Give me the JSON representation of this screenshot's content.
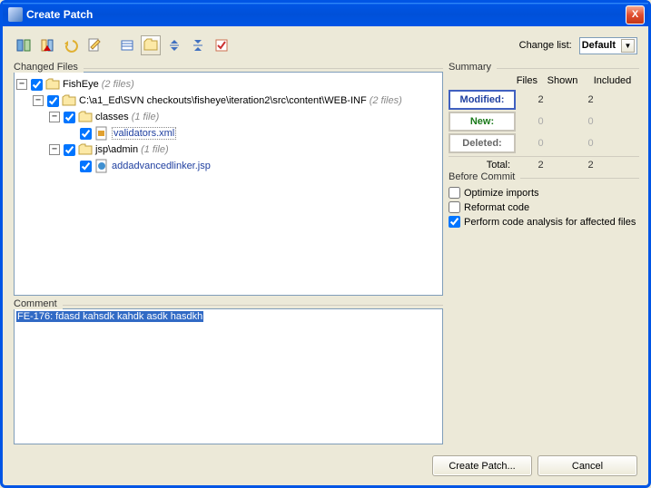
{
  "window": {
    "title": "Create Patch",
    "close_label": "X"
  },
  "toolbar": {
    "buttons": [
      "compare",
      "diff-options",
      "undo",
      "edit",
      "list",
      "tree",
      "expand-all",
      "collapse-all",
      "validate"
    ],
    "change_list_label": "Change list:",
    "change_list_value": "Default"
  },
  "sections": {
    "changed_files": "Changed Files",
    "comment": "Comment",
    "summary": "Summary",
    "before_commit": "Before Commit"
  },
  "tree": {
    "root": {
      "label": "FishEye",
      "count_label": "(2 files)",
      "checked": true,
      "children": [
        {
          "label": "C:\\a1_Ed\\SVN checkouts\\fisheye\\iteration2\\src\\content\\WEB-INF",
          "count_label": "(2 files)",
          "checked": true,
          "children": [
            {
              "label": "classes",
              "count_label": "(1 file)",
              "checked": true,
              "children": [
                {
                  "file": "validators.xml",
                  "checked": true,
                  "status": "M",
                  "selected": true
                }
              ]
            },
            {
              "label": "jsp\\admin",
              "count_label": "(1 file)",
              "checked": true,
              "children": [
                {
                  "file": "addadvancedlinker.jsp",
                  "checked": true,
                  "status": "Unknown"
                }
              ]
            }
          ]
        }
      ]
    }
  },
  "comment": {
    "text": "FE-176: fdasd kahsdk kahdk asdk hasdkh"
  },
  "summary": {
    "cols": {
      "files": "Files",
      "shown": "Shown",
      "included": "Included"
    },
    "rows": {
      "modified": {
        "label": "Modified:",
        "shown": "2",
        "included": "2"
      },
      "new": {
        "label": "New:",
        "shown": "0",
        "included": "0"
      },
      "deleted": {
        "label": "Deleted:",
        "shown": "0",
        "included": "0"
      }
    },
    "total": {
      "label": "Total:",
      "shown": "2",
      "included": "2"
    }
  },
  "before_commit": {
    "optimize_imports": {
      "label": "Optimize imports",
      "checked": false
    },
    "reformat_code": {
      "label": "Reformat code",
      "checked": false
    },
    "code_analysis": {
      "label": "Perform code analysis for affected files",
      "checked": true
    }
  },
  "footer": {
    "create": "Create Patch...",
    "cancel": "Cancel"
  }
}
